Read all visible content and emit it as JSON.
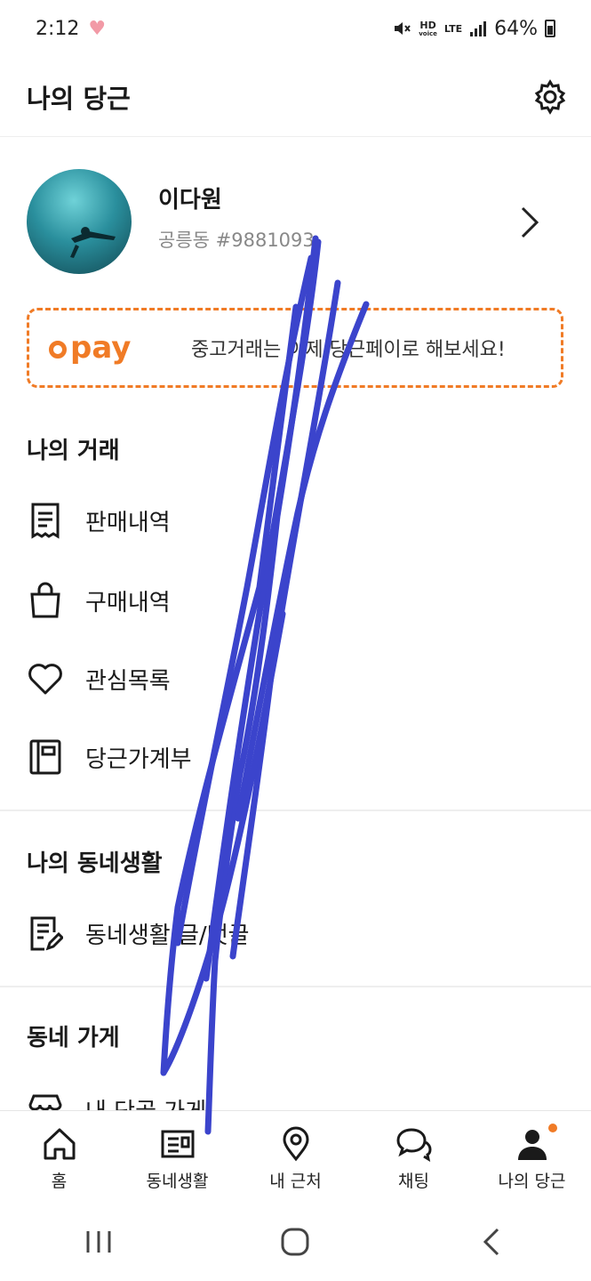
{
  "status_bar": {
    "time": "2:12",
    "heart": "♥",
    "hd": "HD",
    "hd_sub": "voice",
    "lte": "LTE",
    "battery": "64%"
  },
  "header": {
    "title": "나의 당근",
    "settings_icon": "gear-icon"
  },
  "profile": {
    "name": "이다원",
    "sub": "공릉동 #9881093"
  },
  "pay_banner": {
    "logo": "pay",
    "text": "중고거래는 이제 당근페이로 해보세요!"
  },
  "sections": {
    "trade": {
      "title": "나의 거래",
      "items": [
        "판매내역",
        "구매내역",
        "관심목록",
        "당근가계부"
      ]
    },
    "neighborhood": {
      "title": "나의 동네생활",
      "items": [
        "동네생활 글/댓글"
      ]
    },
    "store": {
      "title": "동네 가게",
      "items": [
        "내 단골 가게"
      ]
    }
  },
  "bottom_nav": [
    {
      "label": "홈",
      "icon": "home-icon"
    },
    {
      "label": "동네생활",
      "icon": "newspaper-icon"
    },
    {
      "label": "내 근처",
      "icon": "location-icon"
    },
    {
      "label": "채팅",
      "icon": "chat-icon"
    },
    {
      "label": "나의 당근",
      "icon": "person-icon"
    }
  ],
  "colors": {
    "accent": "#f07b26",
    "scribble": "#3b44cc"
  }
}
